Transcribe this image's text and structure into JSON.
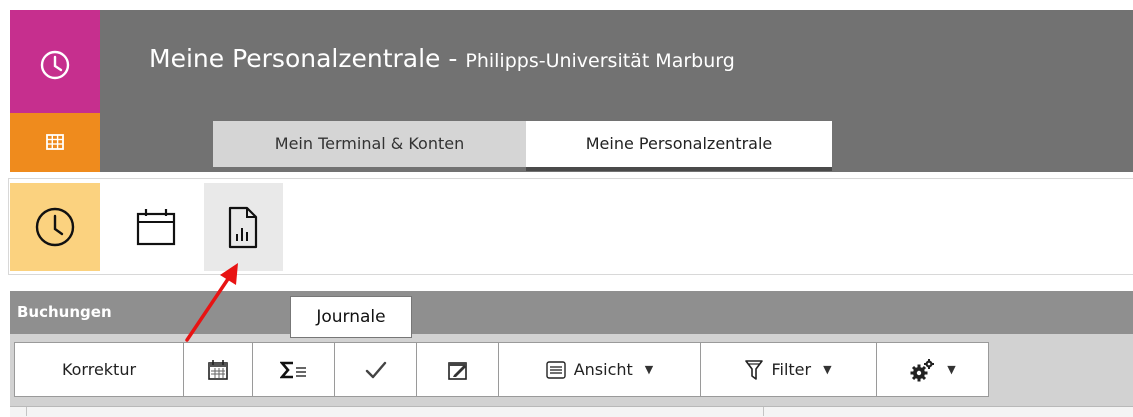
{
  "header": {
    "title": "Meine Personalzentrale",
    "separator": "-",
    "subtitle": "Philipps-Universität Marburg",
    "tabs": [
      {
        "label": "Mein Terminal & Konten",
        "active": false
      },
      {
        "label": "Meine Personalzentrale",
        "active": true
      }
    ]
  },
  "sidebar": {
    "items": [
      {
        "icon": "clock-icon",
        "color": "#c62f8e"
      },
      {
        "icon": "grid-icon",
        "color": "#ef8b1d"
      }
    ]
  },
  "toolbar": {
    "items": [
      {
        "icon": "clock-icon",
        "active": true,
        "color": "#fbd27f"
      },
      {
        "icon": "calendar-icon",
        "active": false
      },
      {
        "icon": "report-icon",
        "active": false,
        "hovered": true
      }
    ],
    "tooltip": "Journale"
  },
  "panel": {
    "title": "Buchungen",
    "actions": {
      "korrektur_label": "Korrektur",
      "calendar_icon": "calendar-grid-icon",
      "sum_icon": "sigma-list-icon",
      "check_icon": "check-icon",
      "edit_icon": "edit-note-icon",
      "ansicht_label": "Ansicht",
      "filter_label": "Filter",
      "settings_icon": "gears-icon"
    }
  },
  "colors": {
    "header_gray": "#727272",
    "pink": "#c62f8e",
    "orange": "#ef8b1d",
    "active_yellow": "#fbd27f",
    "annotation_red": "#e81313"
  }
}
